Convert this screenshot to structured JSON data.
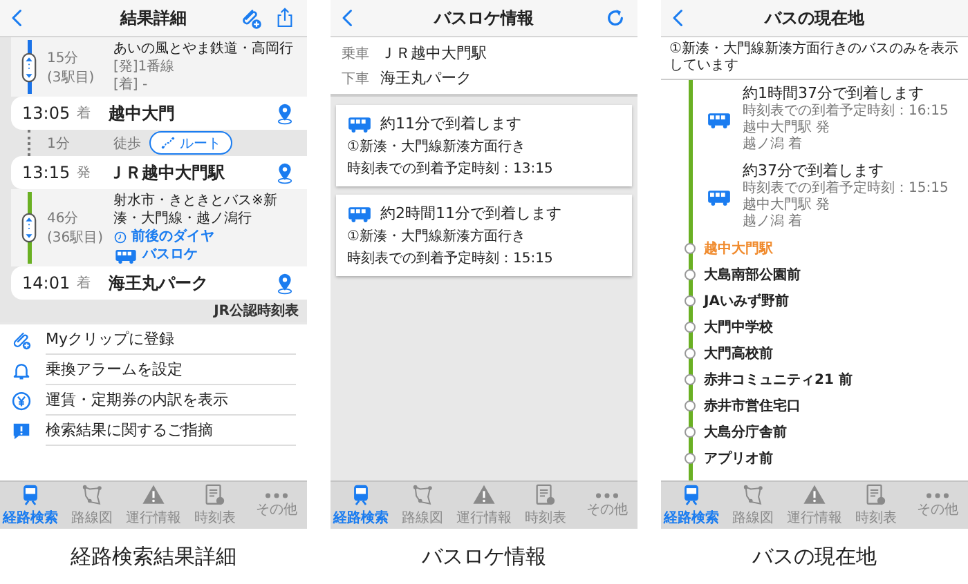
{
  "route_detail": {
    "title": "結果詳細",
    "timeline": [
      {
        "kind": "leg",
        "color": "#1a73e8",
        "duration": "15分",
        "stop_count": "(3駅目)",
        "line": "あいの風とやま鉄道・高岡行",
        "details": [
          "[発]1番線",
          "[着] -"
        ]
      },
      {
        "kind": "stop",
        "time": "13:05",
        "type": "着",
        "name": "越中大門"
      },
      {
        "kind": "walk",
        "duration": "1分",
        "mode": "徒歩",
        "button": "ルート"
      },
      {
        "kind": "stop",
        "time": "13:15",
        "type": "発",
        "name": "ＪＲ越中大門駅"
      },
      {
        "kind": "leg",
        "color": "#6ab023",
        "duration": "46分",
        "stop_count": "(36駅目)",
        "line": "射水市・きときとバス※新湊・大門線・越ノ潟行",
        "links": [
          {
            "kind": "clock",
            "label": "前後のダイヤ"
          },
          {
            "kind": "bus",
            "label": "バスロケ"
          }
        ]
      },
      {
        "kind": "stop",
        "time": "14:01",
        "type": "着",
        "name": "海王丸パーク"
      }
    ],
    "credit": "JR公認時刻表",
    "menu": [
      {
        "kind": "clip",
        "label": "Myクリップに登録"
      },
      {
        "kind": "bell",
        "label": "乗換アラームを設定"
      },
      {
        "kind": "yen",
        "label": "運賃・定期券の内訳を表示"
      },
      {
        "kind": "report",
        "label": "検索結果に関するご指摘"
      }
    ],
    "tab_bar": [
      {
        "kind": "route",
        "label": "経路検索",
        "selected": true
      },
      {
        "kind": "map",
        "label": "路線図",
        "selected": false
      },
      {
        "kind": "alert",
        "label": "運行情報",
        "selected": false
      },
      {
        "kind": "timetable",
        "label": "時刻表",
        "selected": false
      },
      {
        "kind": "more",
        "label": "その他",
        "selected": false
      }
    ],
    "caption": "経路検索結果詳細"
  },
  "bus_location": {
    "title": "バスロケ情報",
    "trip": [
      {
        "label": "乗車",
        "value": "ＪＲ越中大門駅"
      },
      {
        "label": "下車",
        "value": "海王丸パーク"
      }
    ],
    "buses": [
      {
        "arrival": "約11分で到着します",
        "route": "①新湊・大門線新湊方面行き",
        "scheduled": "時刻表での到着予定時刻：13:15"
      },
      {
        "arrival": "約2時間11分で到着します",
        "route": "①新湊・大門線新湊方面行き",
        "scheduled": "時刻表での到着予定時刻：15:15"
      }
    ],
    "tab_bar": [
      {
        "kind": "route",
        "label": "経路検索",
        "selected": true
      },
      {
        "kind": "map",
        "label": "路線図",
        "selected": false
      },
      {
        "kind": "alert",
        "label": "運行情報",
        "selected": false
      },
      {
        "kind": "timetable",
        "label": "時刻表",
        "selected": false
      },
      {
        "kind": "more",
        "label": "その他",
        "selected": false
      }
    ],
    "caption": "バスロケ情報"
  },
  "bus_position": {
    "title": "バスの現在地",
    "notice": "①新湊・大門線新湊方面行きのバスのみを表示しています",
    "buses": [
      {
        "arrival": "約1時間37分で到着します",
        "scheduled": "時刻表での到着予定時刻：16:15",
        "from": "越中大門駅 発",
        "to": "越ノ潟 着"
      },
      {
        "arrival": "約37分で到着します",
        "scheduled": "時刻表での到着予定時刻：15:15",
        "from": "越中大門駅 発",
        "to": "越ノ潟 着"
      }
    ],
    "stops": [
      {
        "name": "越中大門駅",
        "current": true
      },
      {
        "name": "大島南部公園前",
        "current": false
      },
      {
        "name": "JAいみず野前",
        "current": false
      },
      {
        "name": "大門中学校",
        "current": false
      },
      {
        "name": "大門高校前",
        "current": false
      },
      {
        "name": "赤井コミュニティ21 前",
        "current": false
      },
      {
        "name": "赤井市営住宅口",
        "current": false
      },
      {
        "name": "大島分庁舎前",
        "current": false
      },
      {
        "name": "アプリオ前",
        "current": false
      }
    ],
    "tab_bar": [
      {
        "kind": "route",
        "label": "経路検索",
        "selected": true
      },
      {
        "kind": "map",
        "label": "路線図",
        "selected": false
      },
      {
        "kind": "alert",
        "label": "運行情報",
        "selected": false
      },
      {
        "kind": "timetable",
        "label": "時刻表",
        "selected": false
      },
      {
        "kind": "more",
        "label": "その他",
        "selected": false
      }
    ],
    "caption": "バスの現在地"
  }
}
